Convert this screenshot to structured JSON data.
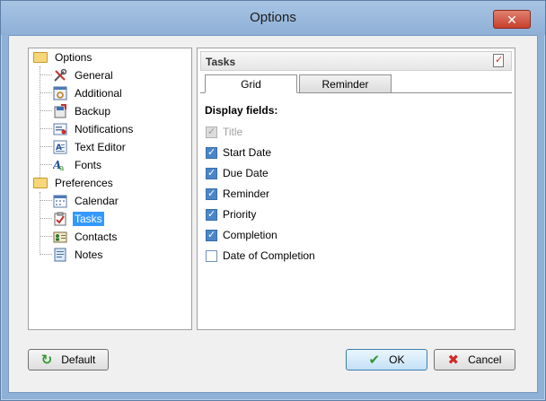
{
  "window": {
    "title": "Options",
    "close_symbol": "✕"
  },
  "tree": {
    "groups": [
      {
        "label": "Options",
        "icon": "folder-icon",
        "items": [
          {
            "label": "General",
            "icon": "tools-icon"
          },
          {
            "label": "Additional",
            "icon": "settings-window-icon"
          },
          {
            "label": "Backup",
            "icon": "backup-icon"
          },
          {
            "label": "Notifications",
            "icon": "notification-icon"
          },
          {
            "label": "Text Editor",
            "icon": "text-editor-icon"
          },
          {
            "label": "Fonts",
            "icon": "fonts-icon"
          }
        ]
      },
      {
        "label": "Preferences",
        "icon": "folder-icon",
        "items": [
          {
            "label": "Calendar",
            "icon": "calendar-icon"
          },
          {
            "label": "Tasks",
            "icon": "tasks-icon",
            "selected": true
          },
          {
            "label": "Contacts",
            "icon": "contacts-icon"
          },
          {
            "label": "Notes",
            "icon": "notes-icon"
          }
        ]
      }
    ]
  },
  "panel": {
    "header": "Tasks",
    "header_icon": "task-clipboard-icon",
    "tabs": [
      {
        "label": "Grid",
        "active": true
      },
      {
        "label": "Reminder",
        "active": false
      }
    ],
    "section_label": "Display fields:",
    "fields": [
      {
        "label": "Title",
        "checked": true,
        "disabled": true
      },
      {
        "label": "Start Date",
        "checked": true,
        "disabled": false
      },
      {
        "label": "Due Date",
        "checked": true,
        "disabled": false
      },
      {
        "label": "Reminder",
        "checked": true,
        "disabled": false
      },
      {
        "label": "Priority",
        "checked": true,
        "disabled": false
      },
      {
        "label": "Completion",
        "checked": true,
        "disabled": false
      },
      {
        "label": "Date of Completion",
        "checked": false,
        "disabled": false
      }
    ]
  },
  "buttons": {
    "default_label": "Default",
    "ok_label": "OK",
    "cancel_label": "Cancel"
  },
  "colors": {
    "selection": "#3399ff",
    "checkbox_checked": "#4a86c8",
    "ok_icon": "#2e9a2e",
    "cancel_icon": "#d02a2a"
  }
}
